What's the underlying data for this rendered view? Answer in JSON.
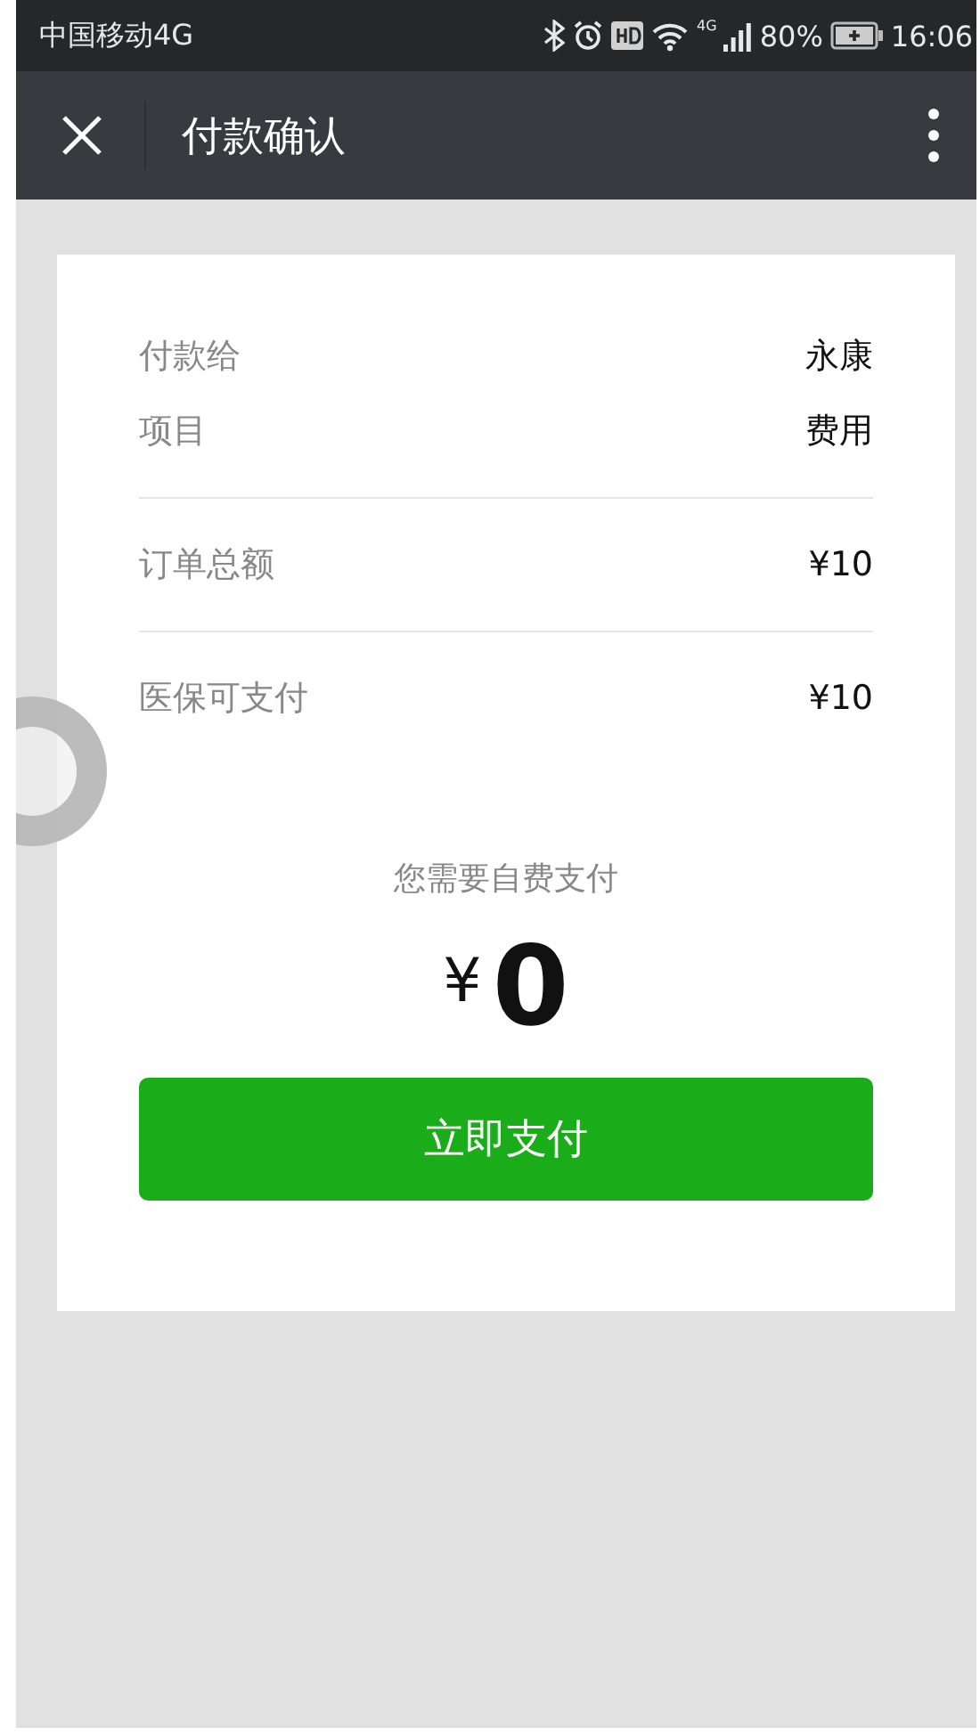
{
  "status_bar": {
    "carrier": "中国移动4G",
    "signal_label": "4G",
    "battery": "80%",
    "time": "16:06"
  },
  "nav": {
    "title": "付款确认"
  },
  "detail_groups": [
    {
      "rows": [
        {
          "label": "付款给",
          "value": "永康"
        },
        {
          "label": "项目",
          "value": "费用"
        }
      ]
    },
    {
      "rows": [
        {
          "label": "订单总额",
          "value": "¥10"
        }
      ]
    },
    {
      "rows": [
        {
          "label": "医保可支付",
          "value": "¥10"
        }
      ]
    }
  ],
  "self_pay": {
    "caption": "您需要自费支付",
    "currency": "¥",
    "amount": "0"
  },
  "pay_button": {
    "label": "立即支付"
  }
}
